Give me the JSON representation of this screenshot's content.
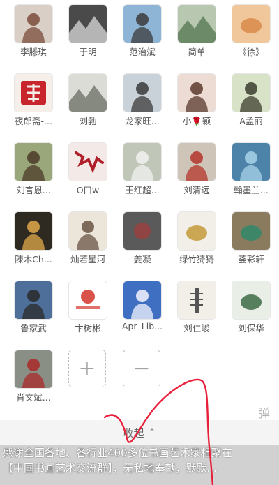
{
  "members": [
    {
      "name": "李滕琪",
      "icon": "portrait-woman-icon",
      "bg": "#d9cfc6",
      "fg": "#7a4b3a"
    },
    {
      "name": "于明",
      "icon": "bw-landscape-photo-icon",
      "bg": "#4a4a4a",
      "fg": "#cfcfcf"
    },
    {
      "name": "范治斌",
      "icon": "portrait-man-outdoor-icon",
      "bg": "#8fb5d6",
      "fg": "#3b3b3b"
    },
    {
      "name": "简单",
      "icon": "landscape-lake-icon",
      "bg": "#b8c8b0",
      "fg": "#5a7a56"
    },
    {
      "name": "《徐》",
      "icon": "sunset-heart-icon",
      "bg": "#f0c79a",
      "fg": "#d98a4a"
    },
    {
      "name": "夜郎斋-...",
      "icon": "red-seal-calligraphy-icon",
      "bg": "#f6efe9",
      "fg": "#c8252c"
    },
    {
      "name": "刘勃",
      "icon": "ink-mountain-painting-icon",
      "bg": "#dadcd5",
      "fg": "#6f746a"
    },
    {
      "name": "龙家旺...",
      "icon": "portrait-man-glasses-icon",
      "bg": "#c9d2d8",
      "fg": "#3a3a3a"
    },
    {
      "name": "小🌹颖",
      "icon": "portrait-woman-icon",
      "bg": "#eddcd4",
      "fg": "#5a3a2e"
    },
    {
      "name": "A孟丽",
      "icon": "portrait-woman-outdoor-icon",
      "bg": "#d8e2c6",
      "fg": "#3d3d2e"
    },
    {
      "name": "刘言恩...",
      "icon": "portrait-woman-outdoor-icon",
      "bg": "#9aa77a",
      "fg": "#4a3a28"
    },
    {
      "name": "O口w",
      "icon": "red-maple-leaves-icon",
      "bg": "#f3e9e6",
      "fg": "#b0202a"
    },
    {
      "name": "王红超...",
      "icon": "portrait-woman-flowers-icon",
      "bg": "#c0c7b8",
      "fg": "#f2f2f2"
    },
    {
      "name": "刘清远",
      "icon": "portrait-red-dress-icon",
      "bg": "#cfc4b8",
      "fg": "#b4352b"
    },
    {
      "name": "翰墨兰...",
      "icon": "portrait-blue-hair-icon",
      "bg": "#4d83a8",
      "fg": "#a8d3ea"
    },
    {
      "name": "陳木Ch...",
      "icon": "portrait-moon-silhouette-icon",
      "bg": "#2e2a22",
      "fg": "#e0a84a"
    },
    {
      "name": "灿若星河",
      "icon": "portrait-woman-painting-icon",
      "bg": "#ece6da",
      "fg": "#6a5344"
    },
    {
      "name": "姜凝",
      "icon": "bw-portrait-window-icon",
      "bg": "#5a5a5a",
      "fg": "#a83a3a"
    },
    {
      "name": "绿竹猗猗",
      "icon": "golden-lotus-hand-icon",
      "bg": "#f2efe8",
      "fg": "#c49a3a"
    },
    {
      "name": "荟彩轩",
      "icon": "jade-stone-icon",
      "bg": "#8a7a5e",
      "fg": "#2f8a6a"
    },
    {
      "name": "鲁家武",
      "icon": "man-painting-desk-icon",
      "bg": "#4d6f9a",
      "fg": "#2a2a2a"
    },
    {
      "name": "卞树彬",
      "icon": "art-studio-logo-icon",
      "bg": "#ffffff",
      "fg": "#d4352b"
    },
    {
      "name": "Apr_Lib...",
      "icon": "anime-character-icon",
      "bg": "#3f6fc0",
      "fg": "#f4f4ff"
    },
    {
      "name": "刘仁峻",
      "icon": "pagoda-painting-icon",
      "bg": "#f1efe8",
      "fg": "#555555"
    },
    {
      "name": "刘保华",
      "icon": "lotus-ink-painting-icon",
      "bg": "#e9eee6",
      "fg": "#3c6b45"
    },
    {
      "name": "肖文斌...",
      "icon": "portrait-man-outdoor-icon",
      "bg": "#8a8f86",
      "fg": "#a82a2a"
    }
  ],
  "controls": {
    "add_symbol": "+",
    "remove_symbol": "−",
    "add_icon": "plus-icon",
    "remove_icon": "minus-icon"
  },
  "side_label": "弹",
  "collapse": {
    "label": "收起",
    "chevron": "⌃",
    "chevron_icon": "chevron-up-icon"
  },
  "caption": {
    "line1": "感谢全国各地、各行业400多位书画艺术家相聚在",
    "line2": "【中国书画艺术交流群】，无私地奉献，默默..."
  },
  "colors": {
    "scribble": "#e8203a",
    "name_text": "#555555"
  }
}
